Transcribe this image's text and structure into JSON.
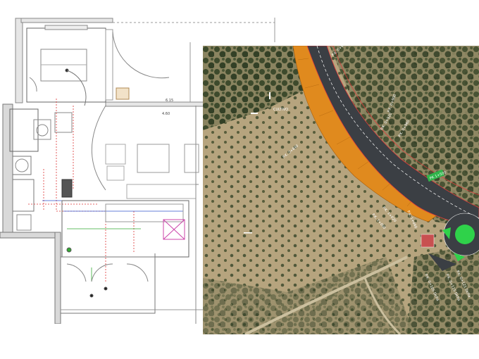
{
  "floorplan": {
    "dimension_labels": [
      "4.60",
      "6.15"
    ]
  },
  "aerial": {
    "road_sign": "PK 1+500",
    "area_label": "CULTIVO",
    "annotations": [
      "P.K. 0+840",
      "P.K. 0+860",
      "P.K. 0+900",
      "P.K. 0+920",
      "P.K. 0+960",
      "P.K. 1+000",
      "P.K. 1+020",
      "P.K. 1+040",
      "P.K. 0+105 Dcha",
      "P.K. 0+115 Dcha",
      "P.K. 0+121 Dcha"
    ],
    "colors": {
      "embankment": "#e08a1e",
      "road": "#3b3f44",
      "sign": "#2fb44a",
      "roundabout_island": "#2fd24a",
      "property_line": "#e23b3b"
    }
  }
}
